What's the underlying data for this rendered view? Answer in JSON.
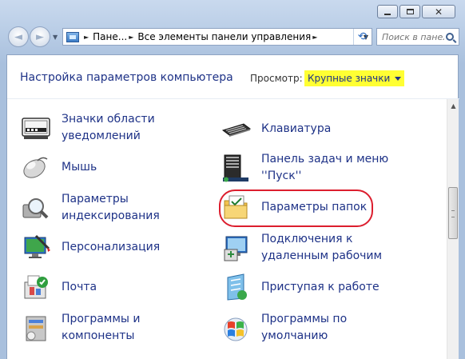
{
  "window": {
    "minimize_glyph": "minimize-icon",
    "maximize_glyph": "maximize-icon",
    "close_glyph": "✕"
  },
  "nav": {
    "back_glyph": "◄",
    "forward_glyph": "►",
    "history_glyph": "▼"
  },
  "address": {
    "crumbs": [
      "Пане...",
      "Все элементы панели управления"
    ],
    "separator": "►",
    "dropdown_glyph": "▼"
  },
  "refresh_glyph": "⟲",
  "search": {
    "placeholder": "Поиск в панели..."
  },
  "header": {
    "title": "Настройка параметров компьютера",
    "view_label": "Просмотр:",
    "view_value": "Крупные значки"
  },
  "items": [
    {
      "label": "Значки области\nуведомлений",
      "icon": "notification-area-icon"
    },
    {
      "label": "Клавиатура",
      "icon": "keyboard-icon"
    },
    {
      "label": "Мышь",
      "icon": "mouse-icon"
    },
    {
      "label": "Панель задач и меню\n''Пуск''",
      "icon": "taskbar-icon"
    },
    {
      "label": "Параметры\nиндексирования",
      "icon": "indexing-icon"
    },
    {
      "label": "Параметры папок",
      "icon": "folder-options-icon"
    },
    {
      "label": "Персонализация",
      "icon": "personalization-icon"
    },
    {
      "label": "Подключения к\nудаленным рабочим",
      "icon": "remote-connections-icon"
    },
    {
      "label": "Почта",
      "icon": "mail-icon"
    },
    {
      "label": "Приступая к работе",
      "icon": "getting-started-icon"
    },
    {
      "label": "Программы и\nкомпоненты",
      "icon": "programs-icon"
    },
    {
      "label": "Программы по\nумолчанию",
      "icon": "default-programs-icon"
    }
  ],
  "colors": {
    "link_text": "#1e3287",
    "view_highlight": "#ffff33",
    "annotation_ring": "#dc1e2e"
  }
}
